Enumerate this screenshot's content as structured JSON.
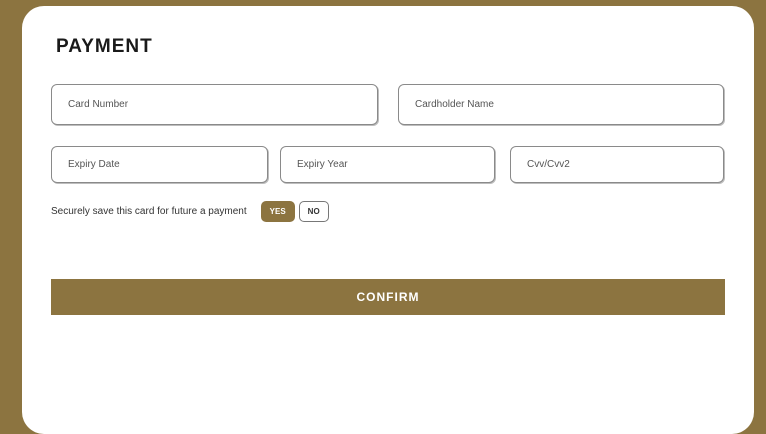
{
  "form": {
    "title": "PAYMENT",
    "card_number_placeholder": "Card Number",
    "cardholder_name_placeholder": "Cardholder Name",
    "expiry_date_placeholder": "Expiry Date",
    "expiry_year_placeholder": "Expiry Year",
    "cvv_placeholder": "Cvv/Cvv2",
    "save_card_label": "Securely save this card for future a payment",
    "yes_label": "YES",
    "no_label": "NO",
    "confirm_label": "CONFIRM"
  },
  "colors": {
    "accent": "#8c7440",
    "card_background": "#ffffff"
  }
}
